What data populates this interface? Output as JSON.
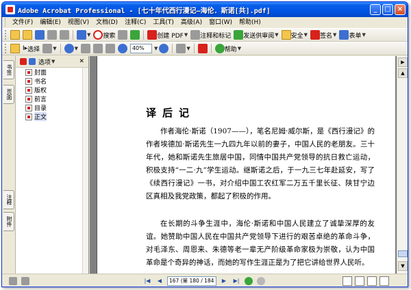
{
  "window": {
    "title": "Adobe Acrobat Professional - [七十年代西行漫记—海伦．斯诺[共].pdf]"
  },
  "menu": [
    "文件(F)",
    "编辑(E)",
    "视图(V)",
    "文档(D)",
    "注释(C)",
    "工具(T)",
    "高级(A)",
    "窗口(W)",
    "帮助(H)"
  ],
  "toolbar": {
    "search_label": "搜索",
    "create_pdf_label": "创建 PDF",
    "review_label": "注释和标记",
    "send_review_label": "发送供审阅",
    "security_label": "安全",
    "sign_label": "签名",
    "forms_label": "表单",
    "select_label": "选择",
    "zoom_value": "40%",
    "help_label": "帮助"
  },
  "left_tabs": [
    "书签",
    "页面",
    "注释",
    "附件"
  ],
  "nav_panel": {
    "options_label": "选项",
    "bookmarks": [
      {
        "label": "封面"
      },
      {
        "label": "书名"
      },
      {
        "label": "版权"
      },
      {
        "label": "前言"
      },
      {
        "label": "目录"
      },
      {
        "label": "正文"
      }
    ]
  },
  "document": {
    "heading": "译后记",
    "paragraph1": "作者海伦·斯诺（1907——），笔名尼姆·威尔斯，是《西行漫记》的作者埃德加·斯诺先生一九四九年以前的妻子，中国人民的老朋友。三十年代，她和斯诺先生旅居中国，同情中国共产党领导的抗日救亡运动，积极支持“一二·九”学生运动。继斯诺之后，于一九三七年赴延安，写了《续西行漫记》一书，对介绍中国工农红军二万五千里长征、陕甘宁边区真相及我党政策，都起了积极的作用。",
    "paragraph2": "在长期的斗争生涯中，海伦·斯诺和中国人民建立了诚挚深厚的友谊。她赞助中国人民在中国共产党领导下进行的艰苦卓绝的革命斗争，对毛泽东、周恩来、朱德等老一辈无产阶级革命家极为崇敬，认为中国革命是个奇异的神话，而她的写作生涯正是为了把它讲给世界人民听。"
  },
  "status": {
    "page_field": "167 (第 180 / 184 页)"
  }
}
